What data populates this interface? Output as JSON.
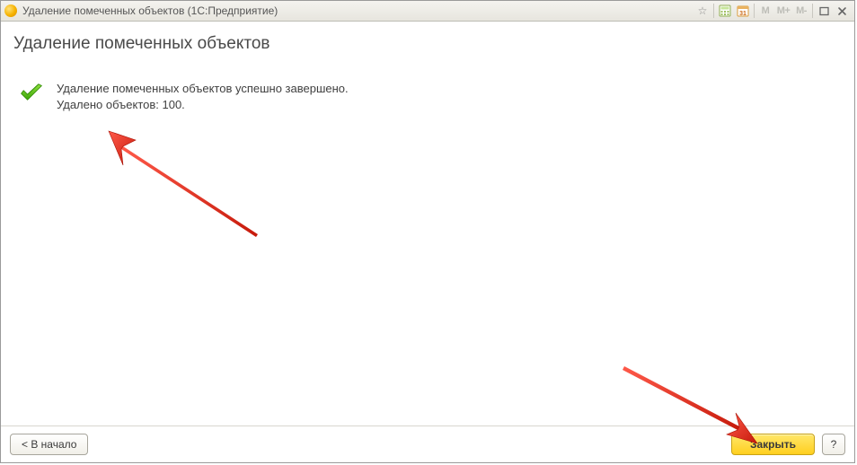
{
  "window": {
    "title": "Удаление помеченных объектов  (1С:Предприятие)"
  },
  "titlebar_icons": {
    "mem_m": "M",
    "mem_mplus": "M+",
    "mem_mminus": "M-"
  },
  "page": {
    "title": "Удаление помеченных объектов"
  },
  "result": {
    "message": "Удаление помеченных объектов успешно завершено.",
    "count_line": "Удалено объектов: 100."
  },
  "footer": {
    "back_label": "< В начало",
    "close_label": "Закрыть",
    "help_label": "?"
  }
}
